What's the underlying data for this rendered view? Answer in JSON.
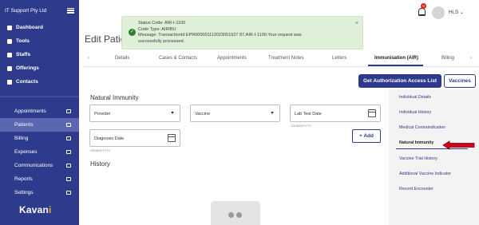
{
  "colors": {
    "brand": "#2e3a8c",
    "sidebar_active": "#5b66b0",
    "toast_bg": "#dff0d8",
    "arrow": "#d0021b"
  },
  "sidebar": {
    "org": "IT Support Pty Ltd",
    "top_items": [
      {
        "label": "Dashboard",
        "icon": "grid-icon"
      },
      {
        "label": "Tools",
        "icon": "wrench-icon"
      },
      {
        "label": "Staffs",
        "icon": "id-card-icon"
      },
      {
        "label": "Offerings",
        "icon": "gear-icon"
      },
      {
        "label": "Contacts",
        "icon": "book-icon"
      }
    ],
    "lower_items": [
      {
        "label": "Appointments",
        "icon": "calendar-icon"
      },
      {
        "label": "Patients",
        "icon": "people-icon",
        "active": true
      },
      {
        "label": "Billing",
        "icon": "card-icon"
      },
      {
        "label": "Expenses",
        "icon": "receipt-icon"
      },
      {
        "label": "Communications",
        "icon": "chat-icon"
      },
      {
        "label": "Reports",
        "icon": "chart-icon"
      },
      {
        "label": "Settings",
        "icon": "gear-icon"
      }
    ],
    "logo_text": "Kavan",
    "logo_end": "i"
  },
  "header": {
    "notification_count": "0",
    "user": "Hi,S"
  },
  "page_title": "Edit Patie",
  "toast": {
    "lines": [
      "Status Code: AIR-I-1100",
      "Code Type: AIRIBU",
      "Message: TransactionId EPR000001112023051927 87,AIR-I-1100:Your request was",
      "successfully processed."
    ],
    "close": "×"
  },
  "tabs": [
    "Details",
    "Cases & Contacts",
    "Appointments",
    "Treatment Notes",
    "Letters",
    "Immunisation (AIR)",
    "Billing"
  ],
  "active_tab": "Immunisation (AIR)",
  "buttons": {
    "get_auth": "Get Authorization Access List",
    "vaccines": "Vaccines",
    "add": "+ Add"
  },
  "form": {
    "title": "Natural Immunity",
    "provider": "Provider",
    "vaccine": "Vaccine",
    "lab_test_date": "Lab Test Date",
    "lab_hint": "DD/MM/YYYY",
    "diagnosis_date": "Diagnosis Date",
    "diagnosis_hint": "DD/MM/YYYY",
    "history_title": "History"
  },
  "right_menu": [
    "Individual Details",
    "Individual History",
    "Medical Contraindication",
    "Natural Immunity",
    "Vaccine Trial History",
    "Additional Vaccine Indicator",
    "Record Encounter"
  ],
  "right_menu_active": "Natural Immunity"
}
